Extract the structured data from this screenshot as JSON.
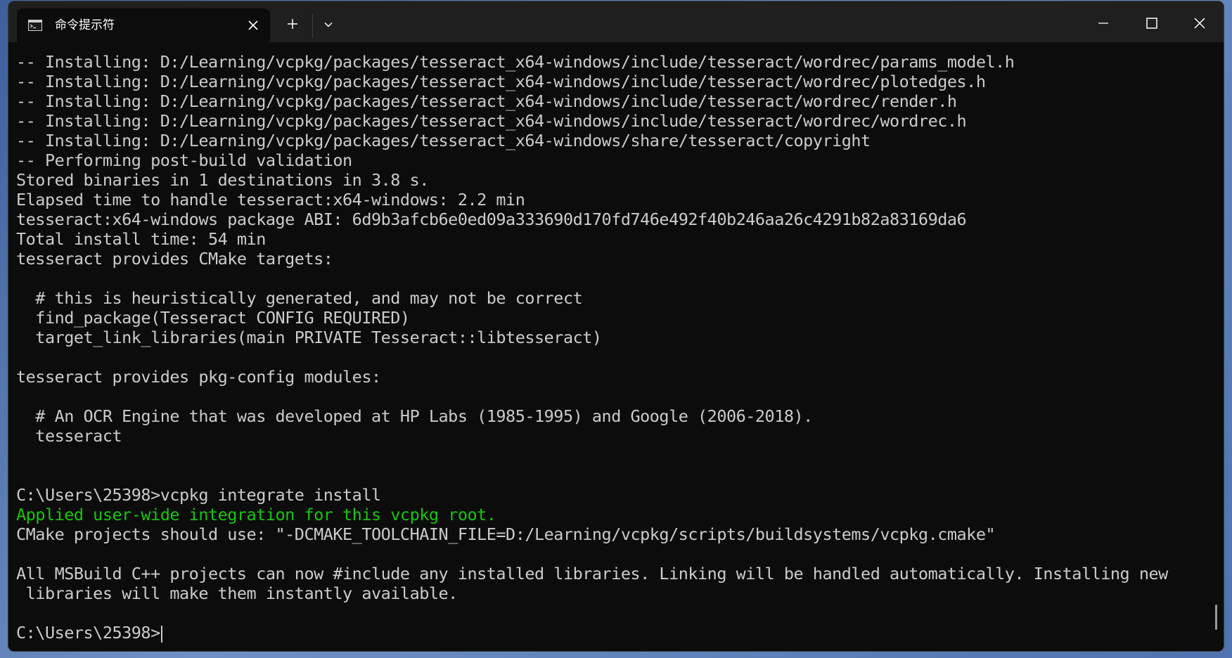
{
  "window": {
    "title": "命令提示符",
    "app_icon": "terminal-icon",
    "buttons": [
      "minimize-icon",
      "maximize-icon",
      "close-icon"
    ],
    "tab_actions": [
      "plus-icon",
      "chevron-down-icon"
    ]
  },
  "colors": {
    "background": "#0c0c0c",
    "text": "#cccccc",
    "success": "#16c60c",
    "titlebar": "#1f1f1f"
  },
  "terminal": {
    "lines": [
      "-- Installing: D:/Learning/vcpkg/packages/tesseract_x64-windows/include/tesseract/wordrec/params_model.h",
      "-- Installing: D:/Learning/vcpkg/packages/tesseract_x64-windows/include/tesseract/wordrec/plotedges.h",
      "-- Installing: D:/Learning/vcpkg/packages/tesseract_x64-windows/include/tesseract/wordrec/render.h",
      "-- Installing: D:/Learning/vcpkg/packages/tesseract_x64-windows/include/tesseract/wordrec/wordrec.h",
      "-- Installing: D:/Learning/vcpkg/packages/tesseract_x64-windows/share/tesseract/copyright",
      "-- Performing post-build validation",
      "Stored binaries in 1 destinations in 3.8 s.",
      "Elapsed time to handle tesseract:x64-windows: 2.2 min",
      "tesseract:x64-windows package ABI: 6d9b3afcb6e0ed09a333690d170fd746e492f40b246aa26c4291b82a83169da6",
      "Total install time: 54 min",
      "tesseract provides CMake targets:",
      "",
      "  # this is heuristically generated, and may not be correct",
      "  find_package(Tesseract CONFIG REQUIRED)",
      "  target_link_libraries(main PRIVATE Tesseract::libtesseract)",
      "",
      "tesseract provides pkg-config modules:",
      "",
      "  # An OCR Engine that was developed at HP Labs (1985-1995) and Google (2006-2018).",
      "  tesseract",
      "",
      "",
      "C:\\Users\\25398>vcpkg integrate install",
      "Applied user-wide integration for this vcpkg root.",
      "CMake projects should use: \"-DCMAKE_TOOLCHAIN_FILE=D:/Learning/vcpkg/scripts/buildsystems/vcpkg.cmake\"",
      "",
      "All MSBuild C++ projects can now #include any installed libraries. Linking will be handled automatically. Installing new",
      " libraries will make them instantly available.",
      "",
      "C:\\Users\\25398>"
    ]
  }
}
